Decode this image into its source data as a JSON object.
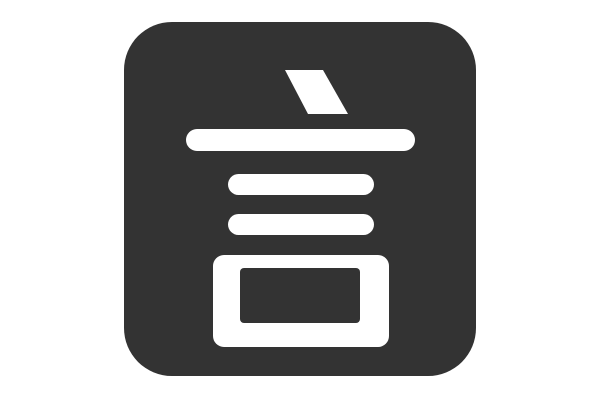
{
  "icon": {
    "name": "yan-character-app-icon",
    "glyph": "言",
    "background_color": "#333333",
    "foreground_color": "#ffffff"
  }
}
